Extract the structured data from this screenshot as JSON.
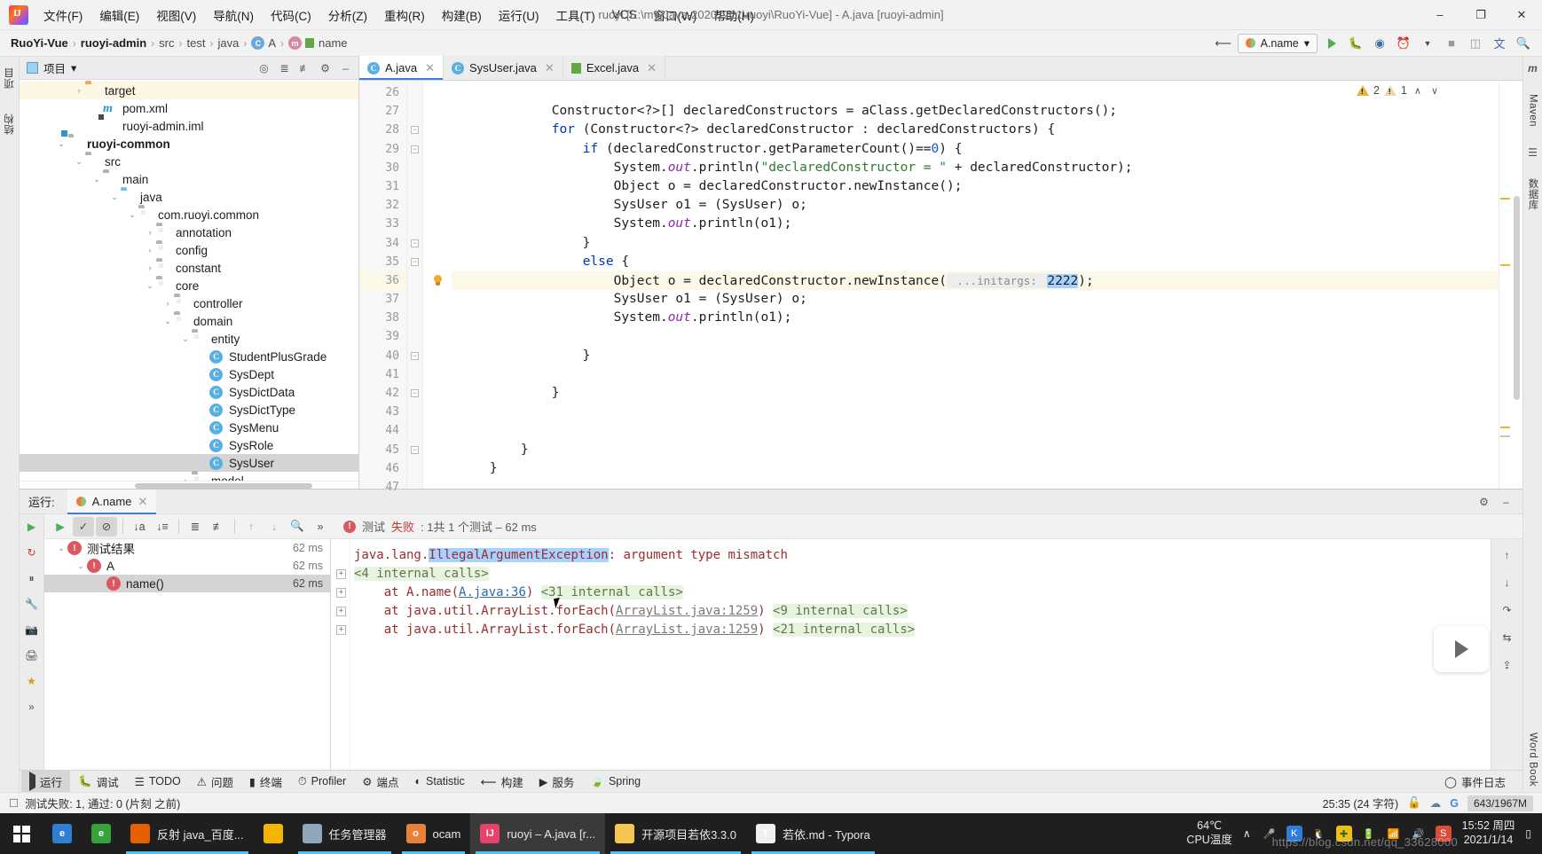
{
  "window": {
    "title": "ruoyi [E:\\my-Java-20201221\\ruoyi\\RuoYi-Vue] - A.java [ruoyi-admin]",
    "minimize": "–",
    "maximize": "❐",
    "close": "✕"
  },
  "menu": {
    "items": [
      "文件(F)",
      "编辑(E)",
      "视图(V)",
      "导航(N)",
      "代码(C)",
      "分析(Z)",
      "重构(R)",
      "构建(B)",
      "运行(U)",
      "工具(T)",
      "VCS",
      "窗口(W)",
      "帮助(H)"
    ]
  },
  "breadcrumb": {
    "items": [
      {
        "label": "RuoYi-Vue",
        "bold": true,
        "icon": ""
      },
      {
        "label": "ruoyi-admin",
        "bold": true,
        "icon": ""
      },
      {
        "label": "src",
        "bold": false,
        "icon": ""
      },
      {
        "label": "test",
        "bold": false,
        "icon": ""
      },
      {
        "label": "java",
        "bold": false,
        "icon": ""
      },
      {
        "label": "A",
        "bold": false,
        "icon": "class-icon"
      },
      {
        "label": "name",
        "bold": false,
        "icon": "method-icon"
      }
    ],
    "separator": "›"
  },
  "nav_right": {
    "build_icon": "hammer-icon",
    "run_config": {
      "name": "A.name",
      "chevron": "▾"
    },
    "run_label": "run-icon",
    "debug_label": "debug-icon",
    "coverage_label": "coverage-icon",
    "profile_label": "profile-icon",
    "stop_label": "stop-icon",
    "layout_label": "layout-icon",
    "search_label": "search-icon",
    "translate_label": "translate-icon"
  },
  "left_stripe": {
    "items": [
      "项目",
      "结构"
    ]
  },
  "right_stripe": {
    "items": [
      "Maven",
      "数据库",
      "Word Book"
    ]
  },
  "project_panel": {
    "title": "项目",
    "chevron": "▾",
    "tools": [
      "locate-icon",
      "expand-all-icon",
      "collapse-all-icon",
      "gear-icon",
      "hide-icon"
    ],
    "tree": [
      {
        "indent": 3,
        "arrow": "›",
        "icon": "folder-orange",
        "label": "target",
        "state": "highlight"
      },
      {
        "indent": 4,
        "arrow": "",
        "icon": "maven-xml",
        "label": "pom.xml",
        "state": ""
      },
      {
        "indent": 4,
        "arrow": "",
        "icon": "iml-file",
        "label": "ruoyi-admin.iml",
        "state": ""
      },
      {
        "indent": 2,
        "arrow": "⌄",
        "icon": "module-folder",
        "label": "ruoyi-common",
        "state": "bold"
      },
      {
        "indent": 3,
        "arrow": "⌄",
        "icon": "folder-grey",
        "label": "src",
        "state": ""
      },
      {
        "indent": 4,
        "arrow": "⌄",
        "icon": "folder-grey",
        "label": "main",
        "state": ""
      },
      {
        "indent": 5,
        "arrow": "⌄",
        "icon": "folder-blue",
        "label": "java",
        "state": ""
      },
      {
        "indent": 6,
        "arrow": "⌄",
        "icon": "package",
        "label": "com.ruoyi.common",
        "state": ""
      },
      {
        "indent": 7,
        "arrow": "›",
        "icon": "package",
        "label": "annotation",
        "state": ""
      },
      {
        "indent": 7,
        "arrow": "›",
        "icon": "package",
        "label": "config",
        "state": ""
      },
      {
        "indent": 7,
        "arrow": "›",
        "icon": "package",
        "label": "constant",
        "state": ""
      },
      {
        "indent": 7,
        "arrow": "⌄",
        "icon": "package",
        "label": "core",
        "state": ""
      },
      {
        "indent": 8,
        "arrow": "›",
        "icon": "package",
        "label": "controller",
        "state": ""
      },
      {
        "indent": 8,
        "arrow": "⌄",
        "icon": "package",
        "label": "domain",
        "state": ""
      },
      {
        "indent": 9,
        "arrow": "⌄",
        "icon": "package",
        "label": "entity",
        "state": ""
      },
      {
        "indent": 10,
        "arrow": "",
        "icon": "java-class",
        "label": "StudentPlusGrade",
        "state": ""
      },
      {
        "indent": 10,
        "arrow": "",
        "icon": "java-class",
        "label": "SysDept",
        "state": ""
      },
      {
        "indent": 10,
        "arrow": "",
        "icon": "java-class",
        "label": "SysDictData",
        "state": ""
      },
      {
        "indent": 10,
        "arrow": "",
        "icon": "java-class",
        "label": "SysDictType",
        "state": ""
      },
      {
        "indent": 10,
        "arrow": "",
        "icon": "java-class",
        "label": "SysMenu",
        "state": ""
      },
      {
        "indent": 10,
        "arrow": "",
        "icon": "java-class",
        "label": "SysRole",
        "state": ""
      },
      {
        "indent": 10,
        "arrow": "",
        "icon": "java-class",
        "label": "SysUser",
        "state": "selected"
      },
      {
        "indent": 9,
        "arrow": "›",
        "icon": "package",
        "label": "model",
        "state": ""
      }
    ]
  },
  "editor": {
    "tabs": [
      {
        "label": "A.java",
        "icon": "java-class",
        "active": true,
        "close": "✕"
      },
      {
        "label": "SysUser.java",
        "icon": "java-class",
        "active": false,
        "close": "✕"
      },
      {
        "label": "Excel.java",
        "icon": "green-file",
        "active": false,
        "close": "✕"
      }
    ],
    "inspection": {
      "warnings": "2",
      "weak_warnings": "1",
      "up": "∧",
      "down": "∨"
    },
    "first_line": 26,
    "lines": [
      {
        "n": 26,
        "fold": "",
        "gutter": "",
        "html": "",
        "hl": false
      },
      {
        "n": 27,
        "fold": "",
        "gutter": "",
        "html": "            Constructor<?>[] declaredConstructors = aClass.getDeclaredConstructors();",
        "hl": false
      },
      {
        "n": 28,
        "fold": "-",
        "gutter": "",
        "html": "            <k>for</k> (Constructor<?> declaredConstructor : declaredConstructors) {",
        "hl": false
      },
      {
        "n": 29,
        "fold": "-",
        "gutter": "",
        "html": "                <k>if</k> (declaredConstructor.getParameterCount()==<n>0</n>) {",
        "hl": false
      },
      {
        "n": 30,
        "fold": "",
        "gutter": "",
        "html": "                    System.<f>out</f>.println(<s>\"declaredConstructor = \"</s> + declaredConstructor);",
        "hl": false
      },
      {
        "n": 31,
        "fold": "",
        "gutter": "",
        "html": "                    Object o = declaredConstructor.newInstance();",
        "hl": false
      },
      {
        "n": 32,
        "fold": "",
        "gutter": "",
        "html": "                    SysUser o1 = (SysUser) o;",
        "hl": false
      },
      {
        "n": 33,
        "fold": "",
        "gutter": "",
        "html": "                    System.<f>out</f>.println(o1);",
        "hl": false
      },
      {
        "n": 34,
        "fold": "-",
        "gutter": "",
        "html": "                }",
        "hl": false
      },
      {
        "n": 35,
        "fold": "-",
        "gutter": "",
        "html": "                <k>else</k> {",
        "hl": false
      },
      {
        "n": 36,
        "fold": "",
        "gutter": "bulb",
        "html": "                    Object o = declaredConstructor.newInstance(<h> ...initargs: </h><sel>2222</sel>);",
        "hl": true
      },
      {
        "n": 37,
        "fold": "",
        "gutter": "",
        "html": "                    SysUser o1 = (SysUser) o;",
        "hl": false
      },
      {
        "n": 38,
        "fold": "",
        "gutter": "",
        "html": "                    System.<f>out</f>.println(o1);",
        "hl": false
      },
      {
        "n": 39,
        "fold": "",
        "gutter": "",
        "html": "",
        "hl": false
      },
      {
        "n": 40,
        "fold": "-",
        "gutter": "",
        "html": "                }",
        "hl": false
      },
      {
        "n": 41,
        "fold": "",
        "gutter": "",
        "html": "",
        "hl": false
      },
      {
        "n": 42,
        "fold": "-",
        "gutter": "",
        "html": "            }",
        "hl": false
      },
      {
        "n": 43,
        "fold": "",
        "gutter": "",
        "html": "",
        "hl": false
      },
      {
        "n": 44,
        "fold": "",
        "gutter": "",
        "html": "",
        "hl": false
      },
      {
        "n": 45,
        "fold": "-",
        "gutter": "",
        "html": "        }",
        "hl": false
      },
      {
        "n": 46,
        "fold": "",
        "gutter": "",
        "html": "    }",
        "hl": false
      },
      {
        "n": 47,
        "fold": "",
        "gutter": "",
        "html": "",
        "hl": false
      }
    ]
  },
  "run_panel": {
    "label": "运行:",
    "tab": {
      "label": "A.name",
      "close": "✕",
      "icon": "run-config-icon"
    },
    "settings_icon": "gear-icon",
    "minimize_icon": "minimize-icon",
    "toolbar": {
      "rerun": "rerun-icon",
      "buttons": [
        "show-passed-icon",
        "hide-ignored-icon",
        "sort-alpha-icon",
        "sort-duration-icon",
        "expand-all-icon",
        "collapse-all-icon",
        "prev-failed-icon",
        "next-failed-icon",
        "history-icon"
      ],
      "overflow": "»"
    },
    "status": {
      "prefix": "测试",
      "state": "失败",
      "detail": ": 1共 1 个测试 – 62 ms"
    },
    "left_icons": [
      "rerun-failed-icon",
      "pause-icon",
      "wrench-icon",
      "camera-icon",
      "print-icon",
      "pin-icon"
    ],
    "test_tree": [
      {
        "indent": 0,
        "arrow": "⌄",
        "label": "测试结果",
        "time": "62 ms",
        "selected": false
      },
      {
        "indent": 1,
        "arrow": "⌄",
        "label": "A",
        "time": "62 ms",
        "selected": false
      },
      {
        "indent": 2,
        "arrow": "",
        "label": "name()",
        "time": "62 ms",
        "selected": true
      }
    ],
    "console": [
      {
        "fold": "",
        "segments": [
          {
            "t": "java.lang.",
            "c": "err"
          },
          {
            "t": "IllegalArgumentException",
            "c": "sel"
          },
          {
            "t": ": argument type mismatch",
            "c": "err"
          }
        ]
      },
      {
        "fold": "+",
        "segments": [
          {
            "t": "<4 internal calls>",
            "c": "folded"
          }
        ]
      },
      {
        "fold": "+",
        "segments": [
          {
            "t": "    at A.name(",
            "c": "err"
          },
          {
            "t": "A.java:36",
            "c": "link"
          },
          {
            "t": ") ",
            "c": "err"
          },
          {
            "t": "<31 internal calls>",
            "c": "folded"
          }
        ]
      },
      {
        "fold": "+",
        "segments": [
          {
            "t": "    at java.util.ArrayList.forEach(",
            "c": "err"
          },
          {
            "t": "ArrayList.java:1259",
            "c": "linkgrey"
          },
          {
            "t": ") ",
            "c": "err"
          },
          {
            "t": "<9 internal calls>",
            "c": "folded"
          }
        ]
      },
      {
        "fold": "+",
        "segments": [
          {
            "t": "    at java.util.ArrayList.forEach(",
            "c": "err"
          },
          {
            "t": "ArrayList.java:1259",
            "c": "linkgrey"
          },
          {
            "t": ") ",
            "c": "err"
          },
          {
            "t": "<21 internal calls>",
            "c": "folded"
          }
        ]
      }
    ],
    "console_right_icons": [
      "scroll-up-icon",
      "scroll-down-icon",
      "soft-wrap-icon",
      "compare-icon",
      "export-icon"
    ]
  },
  "toolwindow_bar": {
    "items": [
      {
        "label": "运行",
        "icon": "run-icon",
        "active": true
      },
      {
        "label": "调试",
        "icon": "debug-icon",
        "active": false
      },
      {
        "label": "TODO",
        "icon": "todo-icon",
        "active": false
      },
      {
        "label": "问题",
        "icon": "problems-icon",
        "active": false
      },
      {
        "label": "终端",
        "icon": "terminal-icon",
        "active": false
      },
      {
        "label": "Profiler",
        "icon": "profiler-icon",
        "active": false
      },
      {
        "label": "端点",
        "icon": "endpoints-icon",
        "active": false
      },
      {
        "label": "Statistic",
        "icon": "statistic-icon",
        "active": false
      },
      {
        "label": "构建",
        "icon": "build-icon",
        "active": false
      },
      {
        "label": "服务",
        "icon": "services-icon",
        "active": false
      },
      {
        "label": "Spring",
        "icon": "spring-icon",
        "active": false
      }
    ],
    "event_log": {
      "label": "事件日志",
      "icon": "balloon-icon"
    }
  },
  "status_bar": {
    "message": "测试失败: 1, 通过: 0 (片刻 之前)",
    "caret": "25:35 (24 字符)",
    "lock_icon": "unlock-icon",
    "cloud_icon": "cloud-icon",
    "google_icon": "google-icon",
    "memory": "643/1967M"
  },
  "taskbar": {
    "start": "windows-start-icon",
    "items": [
      {
        "label": "",
        "icon": "edge-icon",
        "color": "#2d7fd3",
        "glyph": "e",
        "active": false
      },
      {
        "label": "",
        "icon": "360-browser-icon",
        "color": "#35a23c",
        "glyph": "e",
        "active": false
      },
      {
        "label": "反射 java_百度...",
        "icon": "firefox-icon",
        "color": "#e66000",
        "glyph": "",
        "active": false,
        "open": true
      },
      {
        "label": "",
        "icon": "chrome-icon",
        "color": "#f4b400",
        "glyph": "",
        "active": false
      },
      {
        "label": "任务管理器",
        "icon": "task-manager-icon",
        "color": "#8fa6bd",
        "glyph": "",
        "active": false,
        "open": true
      },
      {
        "label": "ocam",
        "icon": "ocam-icon",
        "color": "#e8823a",
        "glyph": "o",
        "active": false,
        "open": true
      },
      {
        "label": "ruoyi – A.java [r...",
        "icon": "intellij-icon",
        "color": "#e8416b",
        "glyph": "IJ",
        "active": true
      },
      {
        "label": "开源项目若依3.3.0",
        "icon": "folder-icon",
        "color": "#f5c451",
        "glyph": "",
        "active": false,
        "open": true
      },
      {
        "label": "若依.md - Typora",
        "icon": "typora-icon",
        "color": "#f0f0f0",
        "glyph": "T",
        "active": false,
        "open": true
      }
    ],
    "cpu_temp": {
      "value": "64℃",
      "label": "CPU温度"
    },
    "tray_expand": "∧",
    "tray_icons": [
      "mic-icon",
      "kugou-icon",
      "qq-icon",
      "360-icon",
      "battery-icon",
      "wifi-icon",
      "volume-icon",
      "sogou-icon"
    ],
    "clock": {
      "time": "15:52 周四",
      "date": "2021/1/14"
    },
    "watermark": "https://blog.csdn.net/qq_33628000",
    "show_desktop": "show-desktop-icon"
  },
  "word_book": {
    "label": "Word Book",
    "play": "play-icon"
  }
}
